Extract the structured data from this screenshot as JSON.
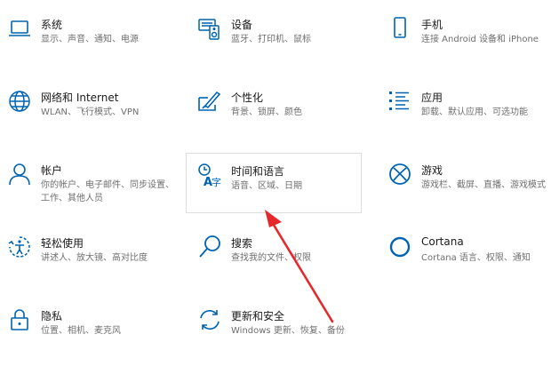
{
  "accent_color": "#0063b1",
  "annotation_color": "#e5282c",
  "tiles": [
    {
      "id": "system",
      "icon": "laptop-icon",
      "title": "系统",
      "desc": "显示、声音、通知、电源"
    },
    {
      "id": "devices",
      "icon": "devices-icon",
      "title": "设备",
      "desc": "蓝牙、打印机、鼠标"
    },
    {
      "id": "phone",
      "icon": "phone-icon",
      "title": "手机",
      "desc": "连接 Android 设备和 iPhone"
    },
    {
      "id": "network",
      "icon": "globe-icon",
      "title": "网络和 Internet",
      "desc": "WLAN、飞行模式、VPN"
    },
    {
      "id": "personalization",
      "icon": "paint-icon",
      "title": "个性化",
      "desc": "背景、锁屏、颜色"
    },
    {
      "id": "apps",
      "icon": "apps-list-icon",
      "title": "应用",
      "desc": "卸载、默认应用、可选功能"
    },
    {
      "id": "accounts",
      "icon": "person-icon",
      "title": "帐户",
      "desc": "你的帐户、电子邮件、同步设置、工作、其他人员"
    },
    {
      "id": "time-language",
      "icon": "time-language-icon",
      "title": "时间和语言",
      "desc": "语音、区域、日期"
    },
    {
      "id": "gaming",
      "icon": "xbox-icon",
      "title": "游戏",
      "desc": "游戏栏、截屏、直播、游戏模式"
    },
    {
      "id": "ease-of-access",
      "icon": "ease-of-access-icon",
      "title": "轻松使用",
      "desc": "讲述人、放大镜、高对比度"
    },
    {
      "id": "search",
      "icon": "search-icon",
      "title": "搜索",
      "desc": "查找我的文件、权限"
    },
    {
      "id": "cortana",
      "icon": "cortana-icon",
      "title": "Cortana",
      "desc": "Cortana 语言、权限、通知"
    },
    {
      "id": "privacy",
      "icon": "lock-icon",
      "title": "隐私",
      "desc": "位置、相机、麦克风"
    },
    {
      "id": "update-security",
      "icon": "update-icon",
      "title": "更新和安全",
      "desc": "Windows 更新、恢复、备份"
    }
  ]
}
